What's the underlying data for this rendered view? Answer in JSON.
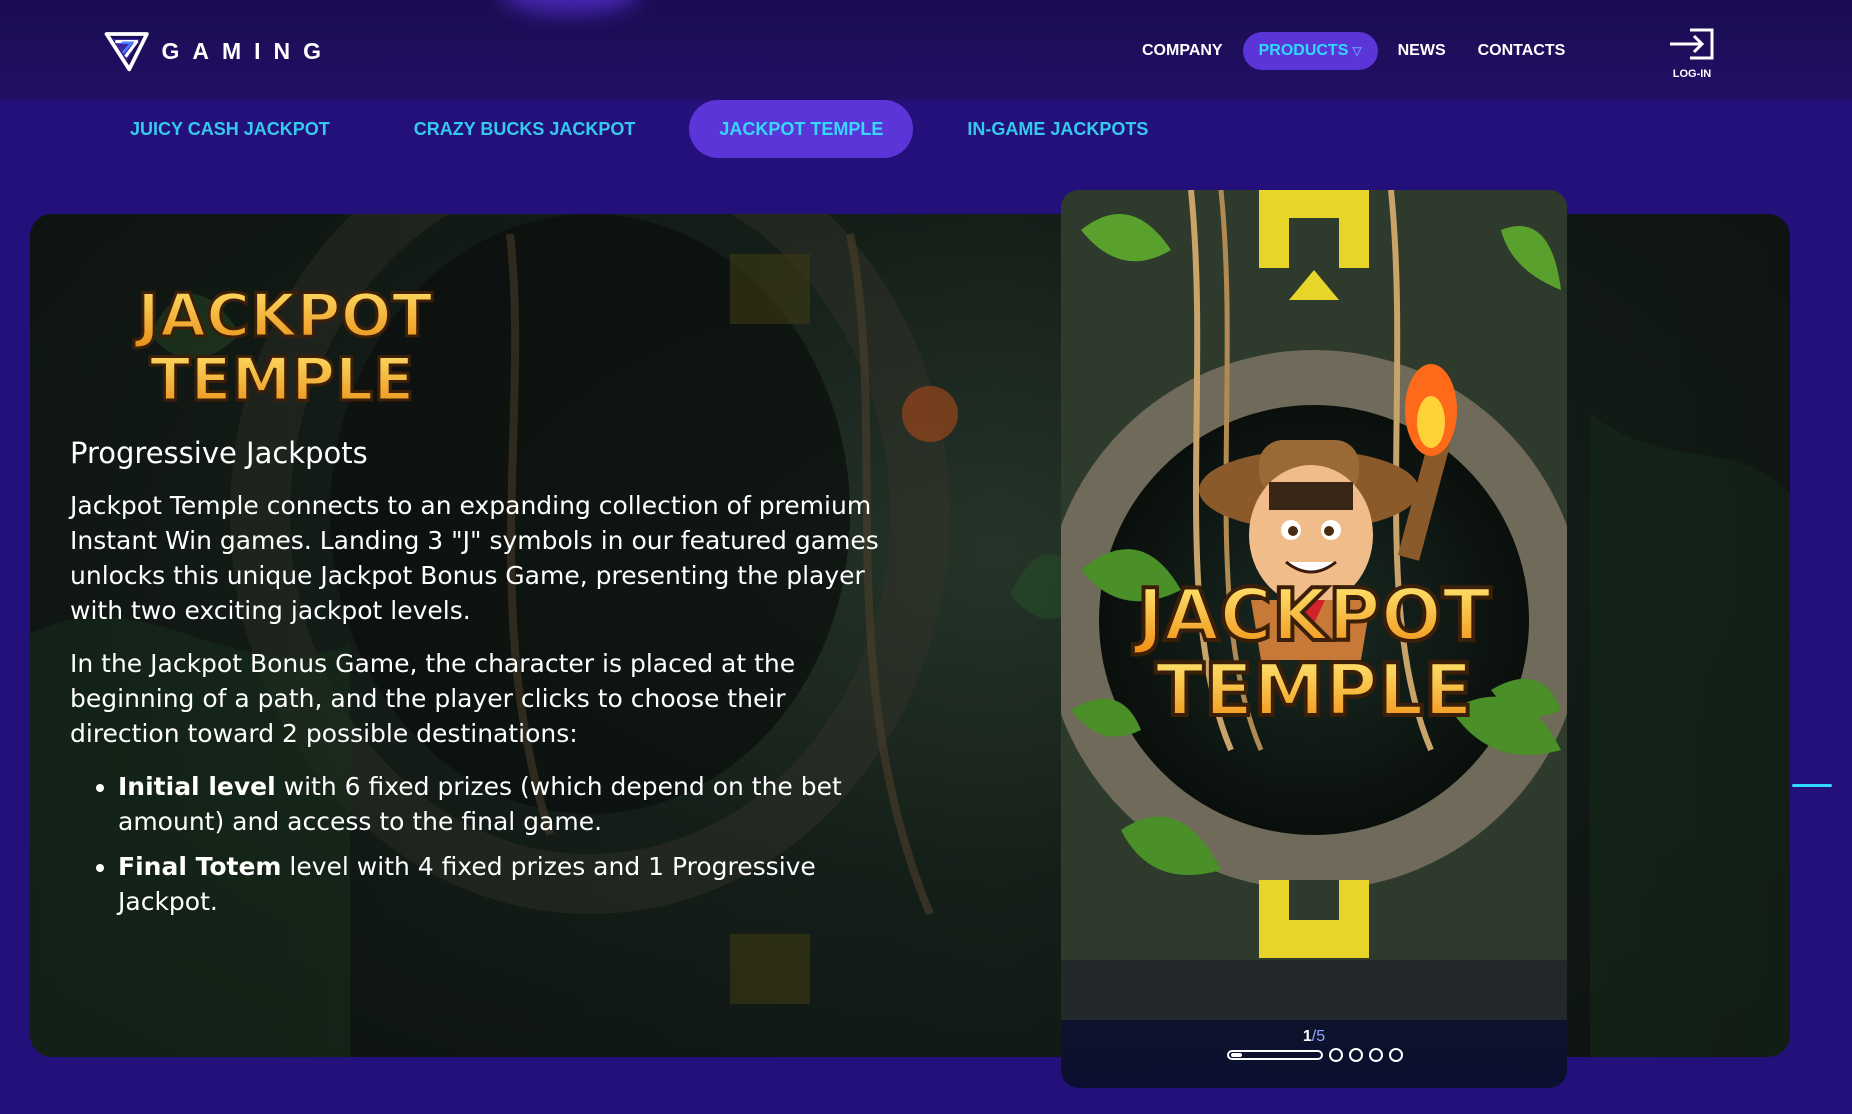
{
  "brand": {
    "logo_text": "GAMING"
  },
  "nav": {
    "items": [
      {
        "label": "COMPANY"
      },
      {
        "label": "PRODUCTS",
        "caret": "▽"
      },
      {
        "label": "NEWS"
      },
      {
        "label": "CONTACTS"
      }
    ],
    "login_label": "LOG-IN"
  },
  "subnav": {
    "items": [
      {
        "label": "JUICY CASH JACKPOT"
      },
      {
        "label": "CRAZY BUCKS JACKPOT"
      },
      {
        "label": "JACKPOT TEMPLE"
      },
      {
        "label": "IN-GAME JACKPOTS"
      }
    ]
  },
  "hero": {
    "logo_line1": "JACKPOT",
    "logo_line2": "TEMPLE",
    "heading": "Progressive Jackpots",
    "paragraph1": "Jackpot Temple connects to an expanding collection of premium Instant Win games. Landing 3 \"J\" symbols in our featured games unlocks this unique Jackpot Bonus Game, presenting the player with two exciting jackpot levels.",
    "paragraph2": "In the Jackpot Bonus Game, the character is placed at the beginning of a path, and the player clicks to choose their direction toward 2 possible destinations:",
    "bullets": [
      {
        "bold": "Initial level",
        "text": " with 6 fixed prizes (which depend on the bet amount) and access to the final game."
      },
      {
        "bold": "Final Totem",
        "text": " level with 4 fixed prizes and 1 Progressive Jackpot."
      }
    ]
  },
  "card": {
    "title_line1": "JACKPOT",
    "title_line2": "TEMPLE",
    "slide_current": "1",
    "slide_total": "/5",
    "progress": 0.12
  },
  "colors": {
    "accent_cyan": "#2fd9ff",
    "active_pill": "#5b35d8",
    "page_bg": "#24107a",
    "logo_gold": "#f5b62a"
  }
}
